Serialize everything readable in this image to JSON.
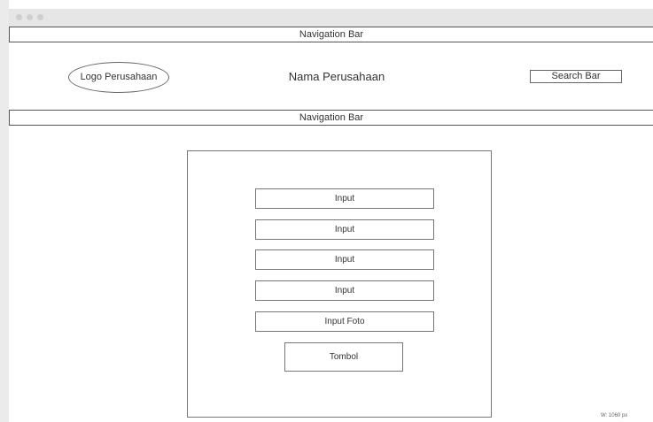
{
  "nav": {
    "top_label": "Navigation Bar",
    "second_label": "Navigation Bar"
  },
  "header": {
    "logo_label": "Logo Perusahaan",
    "company_name": "Nama Perusahaan",
    "search_label": "Search Bar"
  },
  "form": {
    "fields": [
      "Input",
      "Input",
      "Input",
      "Input",
      "Input Foto"
    ],
    "button_label": "Tombol"
  },
  "footer": {
    "width_label": "W: 1060 px"
  }
}
